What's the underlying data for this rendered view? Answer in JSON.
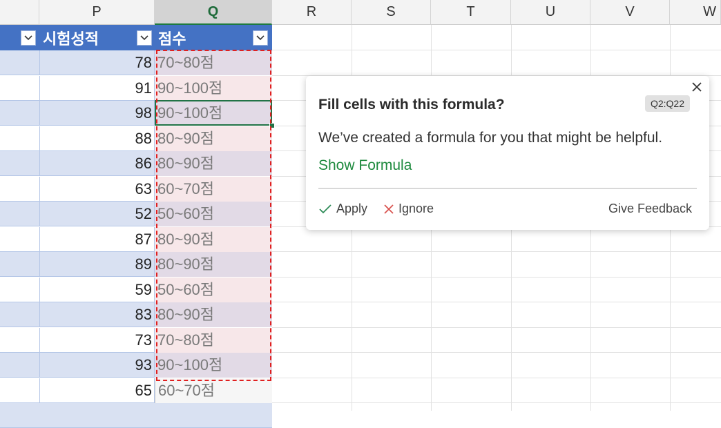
{
  "columns": [
    {
      "name": "P"
    },
    {
      "name": "Q"
    },
    {
      "name": "R"
    },
    {
      "name": "S"
    },
    {
      "name": "T"
    },
    {
      "name": "U"
    },
    {
      "name": "V"
    },
    {
      "name": "W"
    }
  ],
  "selected_column": "Q",
  "table": {
    "header_p": "시험성적",
    "header_q": "점수"
  },
  "rows": [
    {
      "score": "78",
      "grade": "70~80점"
    },
    {
      "score": "91",
      "grade": "90~100점"
    },
    {
      "score": "98",
      "grade": "90~100점"
    },
    {
      "score": "88",
      "grade": "80~90점"
    },
    {
      "score": "86",
      "grade": "80~90점"
    },
    {
      "score": "63",
      "grade": "60~70점"
    },
    {
      "score": "52",
      "grade": "50~60점"
    },
    {
      "score": "87",
      "grade": "80~90점"
    },
    {
      "score": "89",
      "grade": "80~90점"
    },
    {
      "score": "59",
      "grade": "50~60점"
    },
    {
      "score": "83",
      "grade": "80~90점"
    },
    {
      "score": "73",
      "grade": "70~80점"
    },
    {
      "score": "93",
      "grade": "90~100점"
    },
    {
      "score": "65",
      "grade": "60~70점"
    }
  ],
  "popup": {
    "title": "Fill cells with this formula?",
    "range_badge": "Q2:Q22",
    "body": "We’ve created a formula for you that might be helpful.",
    "show_formula": "Show Formula",
    "apply": "Apply",
    "ignore": "Ignore",
    "feedback": "Give Feedback"
  },
  "colors": {
    "header_fill": "#4472c4",
    "band_fill": "#d9e1f2",
    "accent_green": "#1e8a3e",
    "dash_red": "#e02020"
  }
}
